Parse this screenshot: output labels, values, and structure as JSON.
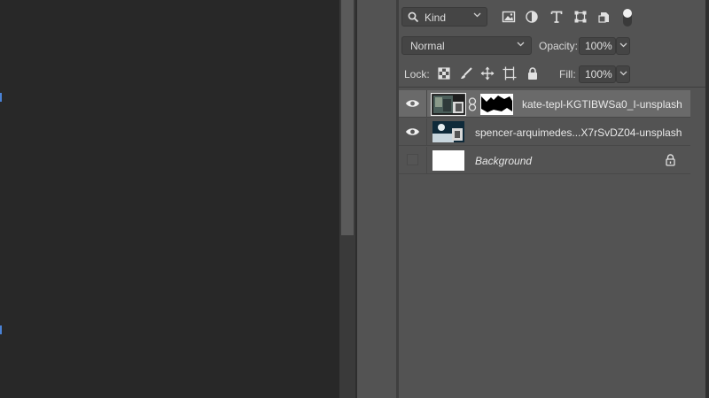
{
  "layers_panel": {
    "filter": {
      "kind_label": "Kind"
    },
    "blend_mode": "Normal",
    "opacity_label": "Opacity:",
    "opacity_value": "100%",
    "lock_label": "Lock:",
    "fill_label": "Fill:",
    "fill_value": "100%",
    "layers": [
      {
        "name": "kate-tepl-KGTIBWSa0_I-unsplash",
        "visible": true,
        "selected": true,
        "has_mask": true
      },
      {
        "name": "spencer-arquimedes...X7rSvDZ04-unsplash",
        "visible": true,
        "selected": false,
        "has_mask": false
      },
      {
        "name": "Background",
        "visible": false,
        "selected": false,
        "locked": true
      }
    ]
  },
  "colors": {
    "panel_bg": "#535353",
    "canvas_bg": "#282828",
    "selected_row": "#6a6a6a"
  }
}
